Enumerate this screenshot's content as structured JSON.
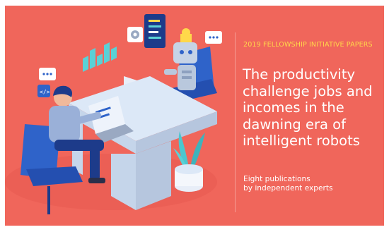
{
  "cover": {
    "kicker": "2019 FELLOWSHIP INITIATIVE PAPERS",
    "title": "The productivity challenge jobs and incomes in the dawning era of intelligent robots",
    "subtitle_line_1": "Eight publications",
    "subtitle_line_2": "by independent experts"
  },
  "colors": {
    "background": "#f0665b",
    "kicker": "#ffd84a",
    "text": "#ffffff",
    "desk": "#cfe0f5",
    "chair": "#2f63c9",
    "robot": "#b9c8dd",
    "plant": "#4cc7cf"
  },
  "illustration": {
    "icons": [
      "chat-bubble-icon",
      "code-icon",
      "gear-icon",
      "bar-chart-icon",
      "document-list-icon",
      "chat-bubble-icon"
    ]
  }
}
